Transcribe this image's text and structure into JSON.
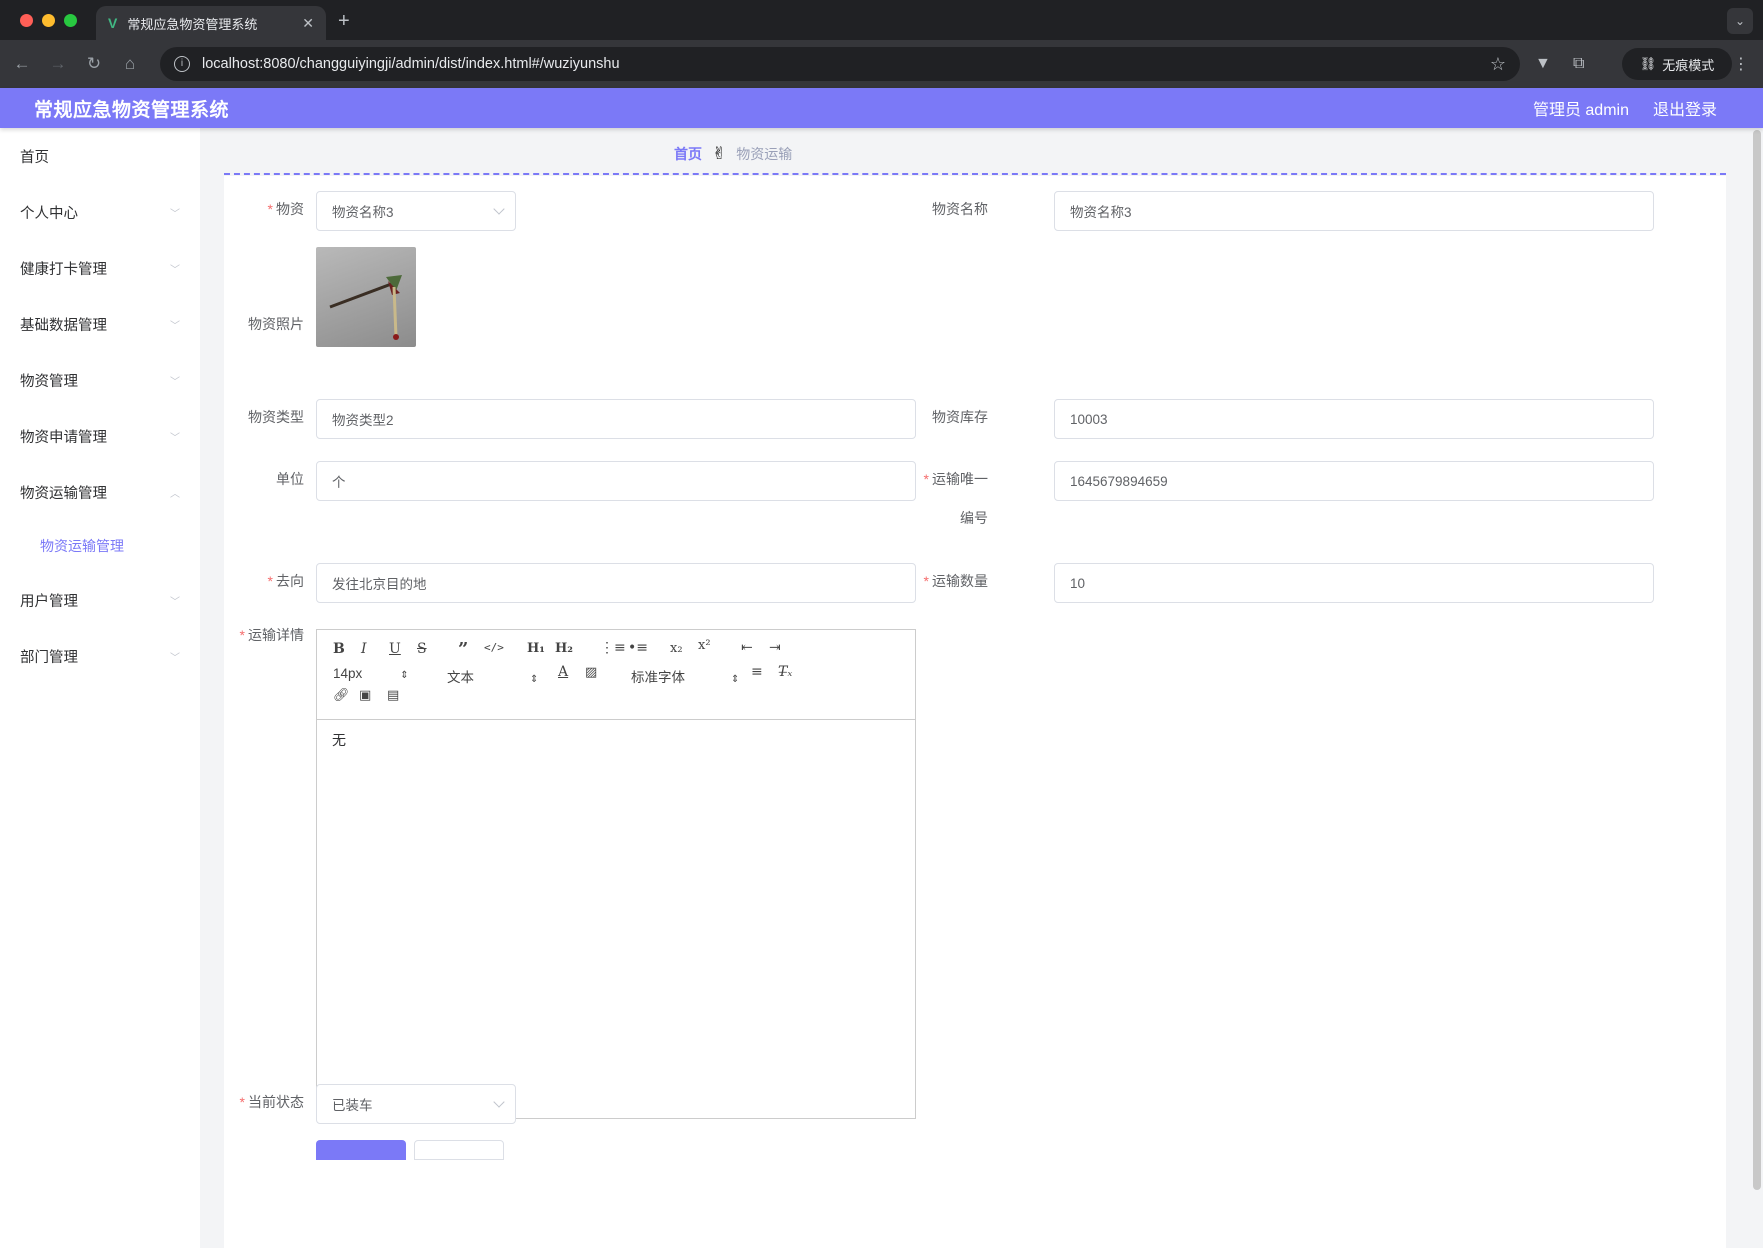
{
  "browser": {
    "tab_title": "常规应急物资管理系统",
    "url": "localhost:8080/changguiyingji/admin/dist/index.html#/wuziyunshu",
    "incognito_label": "无痕模式"
  },
  "header": {
    "title": "常规应急物资管理系统",
    "user_label": "管理员 admin",
    "logout_label": "退出登录"
  },
  "sidebar": {
    "items": [
      {
        "label": "首页"
      },
      {
        "label": "个人中心"
      },
      {
        "label": "健康打卡管理"
      },
      {
        "label": "基础数据管理"
      },
      {
        "label": "物资管理"
      },
      {
        "label": "物资申请管理"
      },
      {
        "label": "物资运输管理"
      },
      {
        "label": "用户管理"
      },
      {
        "label": "部门管理"
      }
    ],
    "sub_item": "物资运输管理"
  },
  "breadcrumb": {
    "home": "首页",
    "separator": "✌",
    "current": "物资运输"
  },
  "form": {
    "wuzi": {
      "label": "物资",
      "value": "物资名称3"
    },
    "wuzi_name": {
      "label": "物资名称",
      "value": "物资名称3"
    },
    "wuzi_photo": {
      "label": "物资照片"
    },
    "wuzi_type": {
      "label": "物资类型",
      "value": "物资类型2"
    },
    "wuzi_stock": {
      "label": "物资库存",
      "value": "10003"
    },
    "unit": {
      "label": "单位",
      "value": "个"
    },
    "transport_no": {
      "label": "运输唯一",
      "label2": "编号",
      "value": "1645679894659"
    },
    "destination": {
      "label": "去向",
      "value": "发往北京目的地"
    },
    "quantity": {
      "label": "运输数量",
      "value": "10"
    },
    "details": {
      "label": "运输详情",
      "content": "无",
      "font_size": "14px",
      "heading": "文本",
      "font_family": "标准字体"
    },
    "status": {
      "label": "当前状态",
      "value": "已装车"
    }
  },
  "colors": {
    "accent": "#7b79f7",
    "required": "#f56c6c"
  }
}
